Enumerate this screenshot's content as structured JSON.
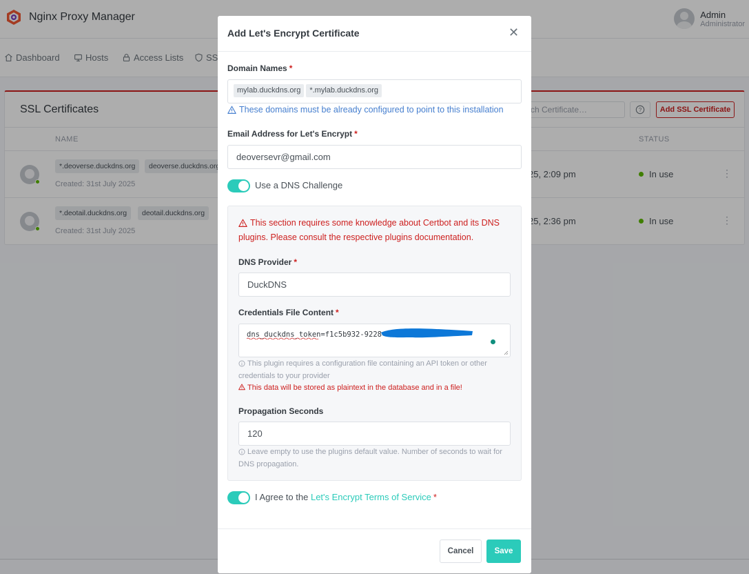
{
  "app": {
    "title": "Nginx Proxy Manager"
  },
  "user": {
    "name": "Admin",
    "role": "Administrator"
  },
  "nav": {
    "dashboard": "Dashboard",
    "hosts": "Hosts",
    "access_lists": "Access Lists",
    "ssl": "SSL"
  },
  "ssl_page": {
    "title": "SSL Certificates",
    "search_placeholder": "Search Certificate…",
    "search_visible": "rch Certificate…",
    "add_button": "Add SSL Certificate",
    "columns": {
      "name": "NAME",
      "status": "STATUS"
    },
    "rows": [
      {
        "domains": [
          "*.deoverse.duckdns.org",
          "deoverse.duckdns.org"
        ],
        "created": "Created: 31st July 2025",
        "expiry_partial": "25, 2:09 pm",
        "status": "In use"
      },
      {
        "domains": [
          "*.deotail.duckdns.org",
          "deotail.duckdns.org"
        ],
        "created": "Created: 31st July 2025",
        "expiry_partial": "25, 2:36 pm",
        "status": "In use"
      }
    ]
  },
  "modal": {
    "title": "Add Let's Encrypt Certificate",
    "domain_names_label": "Domain Names",
    "domains": [
      "mylab.duckdns.org",
      "*.mylab.duckdns.org"
    ],
    "domain_hint": "These domains must be already configured to point to this installation",
    "email_label": "Email Address for Let's Encrypt",
    "email_value": "deoversevr@gmail.com",
    "dns_challenge_label": "Use a DNS Challenge",
    "dns_challenge_on": true,
    "dns_warning": "This section requires some knowledge about Certbot and its DNS plugins. Please consult the respective plugins documentation.",
    "dns_provider_label": "DNS Provider",
    "dns_provider_value": "DuckDNS",
    "credentials_label": "Credentials File Content",
    "credentials_value": "dns_duckdns_token=f1c5b932-9228-",
    "credentials_hint": "This plugin requires a configuration file containing an API token or other credentials to your provider",
    "credentials_warning": "This data will be stored as plaintext in the database and in a file!",
    "propagation_label": "Propagation Seconds",
    "propagation_value": "120",
    "propagation_hint": "Leave empty to use the plugins default value. Number of seconds to wait for DNS propagation.",
    "agree_prefix": "I Agree to the",
    "agree_link": "Let's Encrypt Terms of Service",
    "agree_on": true,
    "cancel_label": "Cancel",
    "save_label": "Save"
  },
  "colors": {
    "accent": "#2bcbba",
    "danger": "#cd201f",
    "info": "#467fcf",
    "status_ok": "#5eba00"
  },
  "icons": [
    "logo-icon",
    "home-icon",
    "monitor-icon",
    "lock-icon",
    "shield-icon",
    "help-icon",
    "close-icon",
    "warning-icon",
    "info-icon",
    "kebab-icon"
  ]
}
